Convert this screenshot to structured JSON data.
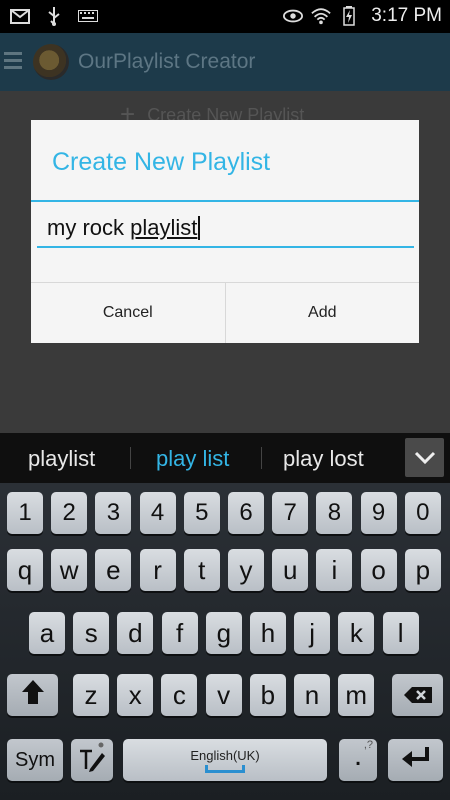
{
  "status_bar": {
    "time": "3:17 PM",
    "icons_left": [
      "mail-icon",
      "usb-icon",
      "keyboard-icon"
    ],
    "icons_right": [
      "eye-icon",
      "wifi-icon",
      "battery-icon"
    ]
  },
  "app_bar": {
    "title": "OurPlaylist Creator",
    "menu_icon": "hamburger-icon",
    "logo_icon": "music-disc-icon"
  },
  "background": {
    "create_row_label": "Create New Playlist"
  },
  "dialog": {
    "title": "Create New Playlist",
    "input": {
      "prefix": "my rock ",
      "composing": "playlist"
    },
    "cancel_label": "Cancel",
    "add_label": "Add"
  },
  "suggestions": {
    "items": [
      "playlist",
      "play list",
      "play lost"
    ],
    "highlight_index": 1,
    "expand_icon": "chevron-down-icon"
  },
  "keyboard": {
    "row1": [
      "1",
      "2",
      "3",
      "4",
      "5",
      "6",
      "7",
      "8",
      "9",
      "0"
    ],
    "row2": [
      "q",
      "w",
      "e",
      "r",
      "t",
      "y",
      "u",
      "i",
      "o",
      "p"
    ],
    "row3": [
      "a",
      "s",
      "d",
      "f",
      "g",
      "h",
      "j",
      "k",
      "l"
    ],
    "row4": [
      "z",
      "x",
      "c",
      "v",
      "b",
      "n",
      "m"
    ],
    "sym_label": "Sym",
    "space_label": "English(UK)",
    "period_label": ".",
    "shift_icon": "shift-icon",
    "backspace_icon": "backspace-icon",
    "enter_icon": "enter-icon",
    "handwriting_icon": "handwriting-icon"
  },
  "colors": {
    "accent": "#33b5e5",
    "dialog_bg": "#f5f5f5"
  }
}
